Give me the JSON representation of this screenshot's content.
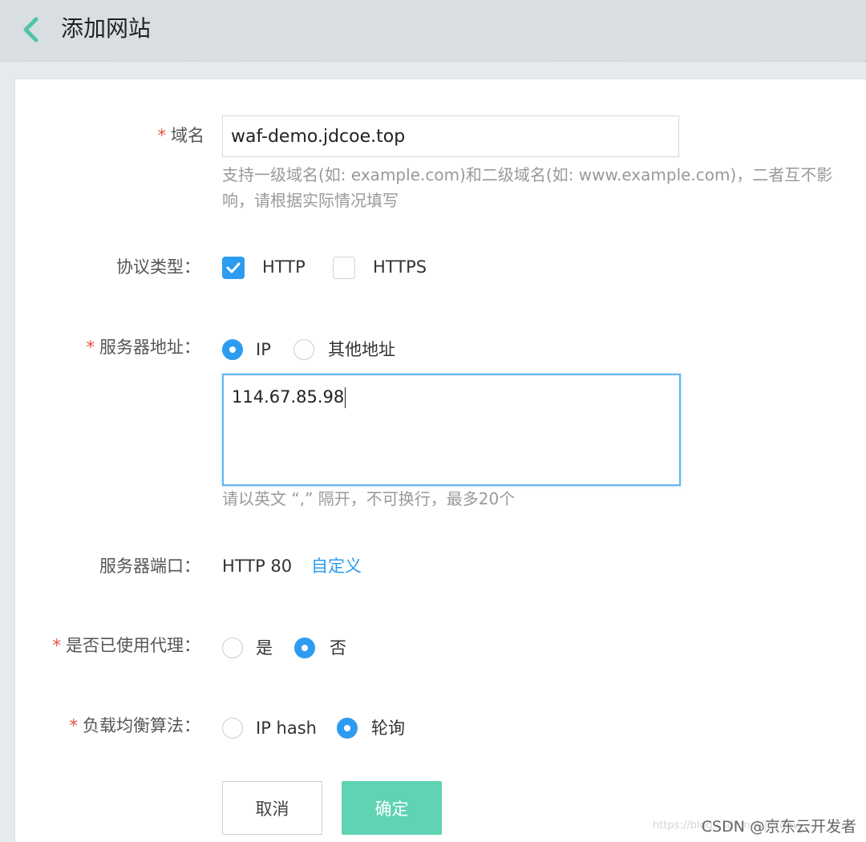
{
  "header": {
    "title": "添加网站",
    "back_icon": "chevron-left-icon",
    "accent": "#52c4a8"
  },
  "form": {
    "domain": {
      "required": "*",
      "label": "域名",
      "value": "waf-demo.jdcoe.top",
      "hint_line1": "支持一级域名(如: example.com)和二级域名(如: www.example.com)，二者互不影",
      "hint_line2": "响，请根据实际情况填写"
    },
    "protocol": {
      "label": "协议类型：",
      "options": [
        {
          "label": "HTTP",
          "checked": true
        },
        {
          "label": "HTTPS",
          "checked": false
        }
      ]
    },
    "server_address": {
      "required": "*",
      "label": "服务器地址：",
      "options": [
        {
          "label": "IP",
          "selected": true
        },
        {
          "label": "其他地址",
          "selected": false
        }
      ],
      "value": "114.67.85.98",
      "hint": "请以英文 “,” 隔开，不可换行，最多20个"
    },
    "server_port": {
      "label": "服务器端口：",
      "value": "HTTP 80",
      "customize_link": "自定义"
    },
    "proxy": {
      "required": "*",
      "label": "是否已使用代理：",
      "options": [
        {
          "label": "是",
          "selected": false
        },
        {
          "label": "否",
          "selected": true
        }
      ]
    },
    "load_balance": {
      "required": "*",
      "label": "负载均衡算法：",
      "options": [
        {
          "label": "IP hash",
          "selected": false
        },
        {
          "label": "轮询",
          "selected": true
        }
      ]
    }
  },
  "buttons": {
    "cancel": "取消",
    "confirm": "确定"
  },
  "watermark": {
    "faint": "https://blog.csdn.net/jdcdev_",
    "main": "CSDN @京东云开发者"
  },
  "colors": {
    "primary": "#2d9cf0",
    "confirm_button": "#5fd3b3",
    "required": "#e5533d"
  }
}
